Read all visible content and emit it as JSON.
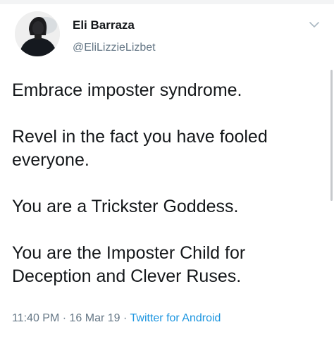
{
  "tweet": {
    "author_name": "Eli Barraza",
    "author_handle": "@EliLizzieLizbet",
    "paragraphs": [
      "Embrace imposter syndrome.",
      "Revel in the fact you have fooled everyone.",
      "You are a Trickster Goddess.",
      "You are the Imposter Child for Deception and Clever Ruses."
    ],
    "time": "11:40 PM",
    "date": "16 Mar 19",
    "separator": " · ",
    "source": "Twitter for Android"
  },
  "icons": {
    "menu": "chevron-down-icon"
  },
  "colors": {
    "text": "#14171a",
    "secondary": "#657786",
    "link": "#1b95e0",
    "background": "#ffffff"
  }
}
